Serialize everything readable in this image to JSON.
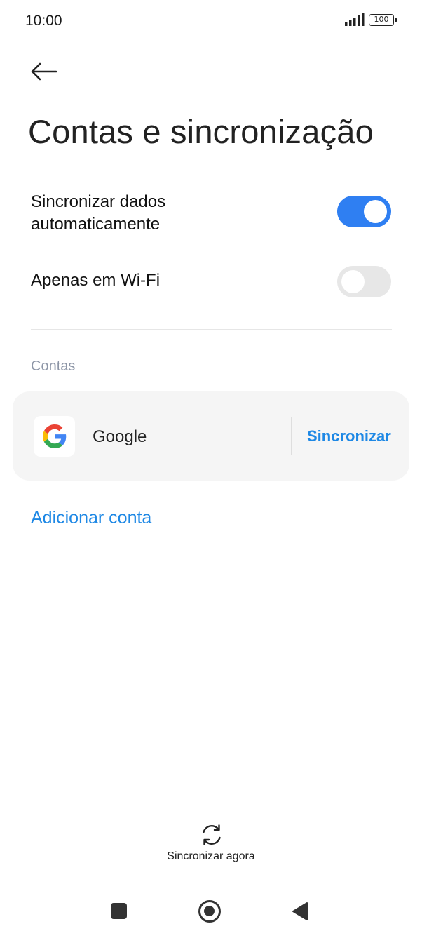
{
  "status_bar": {
    "time": "10:00",
    "battery_level": "100",
    "signal_icon": "signal-icon",
    "battery_icon": "battery-icon"
  },
  "header": {
    "back_icon": "arrow-left-icon",
    "title": "Contas e sincronização"
  },
  "settings": {
    "auto_sync": {
      "label": "Sincronizar dados automaticamente",
      "enabled": true
    },
    "wifi_only": {
      "label": "Apenas em Wi-Fi",
      "enabled": false
    }
  },
  "accounts": {
    "section_label": "Contas",
    "items": [
      {
        "name": "Google",
        "icon": "google-logo-icon",
        "action_label": "Sincronizar"
      }
    ],
    "add_label": "Adicionar conta"
  },
  "footer": {
    "sync_now_label": "Sincronizar agora",
    "sync_now_icon": "sync-icon"
  },
  "nav_bar": {
    "recents_icon": "square-icon",
    "home_icon": "circle-icon",
    "back_icon": "triangle-back-icon"
  },
  "colors": {
    "accent": "#1e88e5",
    "toggle_on": "#2f7ff2",
    "toggle_off": "#e7e7e7",
    "section_label": "#8c95a6",
    "card_background": "#f5f5f5"
  }
}
